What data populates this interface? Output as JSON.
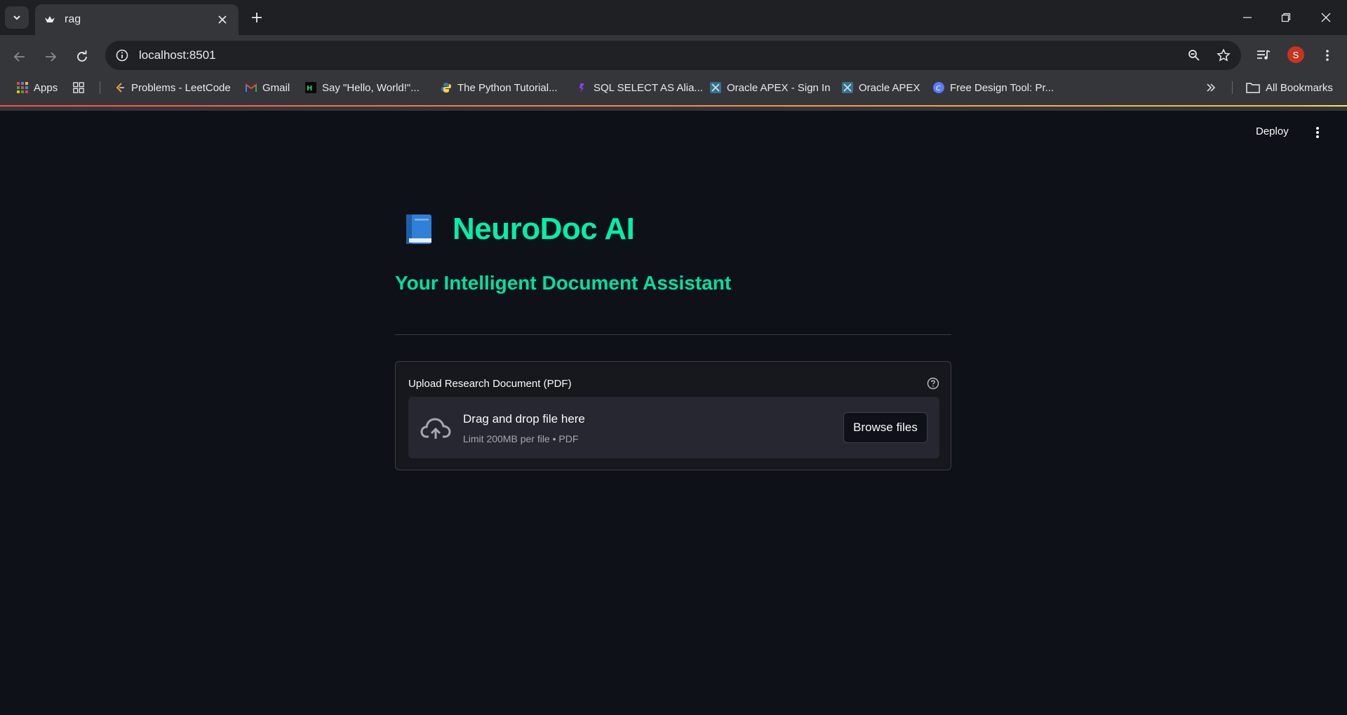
{
  "browser": {
    "tab_title": "rag",
    "url": "localhost:8501",
    "avatar_letter": "S",
    "bookmarks": [
      {
        "label": "Apps",
        "icon": "apps-grid-icon"
      },
      {
        "label": "Problems - LeetCode",
        "icon": "leetcode-icon"
      },
      {
        "label": "Gmail",
        "icon": "gmail-icon"
      },
      {
        "label": "Say \"Hello, World!\"...",
        "icon": "hackerrank-icon"
      },
      {
        "label": "The Python Tutorial...",
        "icon": "python-icon"
      },
      {
        "label": "SQL SELECT AS Alia...",
        "icon": "sql-icon"
      },
      {
        "label": "Oracle APEX - Sign In",
        "icon": "oracle-apex-icon"
      },
      {
        "label": "Oracle APEX",
        "icon": "oracle-apex-icon"
      },
      {
        "label": "Free Design Tool: Pr...",
        "icon": "canva-icon"
      }
    ],
    "all_bookmarks_label": "All Bookmarks"
  },
  "app": {
    "deploy_label": "Deploy",
    "title": "NeuroDoc AI",
    "subtitle": "Your Intelligent Document Assistant",
    "uploader": {
      "label": "Upload Research Document (PDF)",
      "drop_title": "Drag and drop file here",
      "limit_text": "Limit 200MB per file • PDF",
      "browse_label": "Browse files"
    }
  },
  "colors": {
    "accent": "#00f0a8",
    "background": "#0e1117",
    "dropzone": "#262730"
  }
}
